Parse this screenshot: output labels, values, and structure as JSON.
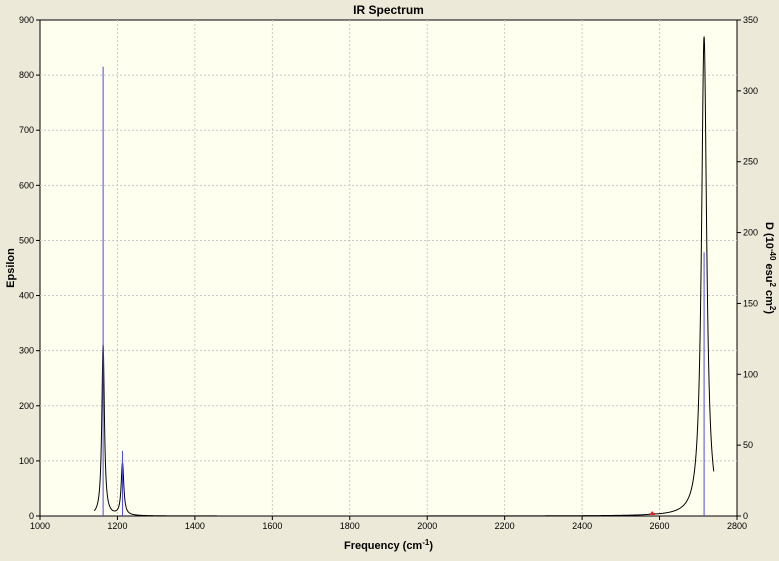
{
  "chart_data": {
    "type": "line",
    "title": "IR Spectrum",
    "xlabel": "Frequency (cm",
    "xlabel_sup": "-1",
    "xlabel_suffix": ")",
    "ylabel_left": "Epsilon",
    "ylabel_right_prefix": "D (10",
    "ylabel_right_sup1": "-40",
    "ylabel_right_mid": " esu",
    "ylabel_right_sup2": "2",
    "ylabel_right_mid2": " cm",
    "ylabel_right_sup3": "2",
    "ylabel_right_suffix": ")",
    "xlim": [
      1000,
      2800
    ],
    "ylim_left": [
      0,
      900
    ],
    "ylim_right": [
      0,
      350
    ],
    "x_ticks": [
      "1000",
      "1200",
      "1400",
      "1600",
      "1800",
      "2000",
      "2200",
      "2400",
      "2600",
      "2800"
    ],
    "y_left_ticks": [
      "0",
      "100",
      "200",
      "300",
      "400",
      "500",
      "600",
      "700",
      "800",
      "900"
    ],
    "y_right_ticks": [
      "0",
      "50",
      "100",
      "150",
      "200",
      "250",
      "300",
      "350"
    ],
    "grid": true,
    "series": [
      {
        "kind": "spectrum",
        "color": "#000000",
        "peaks": [
          {
            "x": 1163,
            "epsilon": 310,
            "hwhm": 4
          },
          {
            "x": 1213,
            "epsilon": 95,
            "hwhm": 4
          },
          {
            "x": 2581,
            "epsilon": 2,
            "hwhm": 4
          },
          {
            "x": 2715,
            "epsilon": 870,
            "hwhm": 8
          }
        ],
        "x_range": [
          1140,
          2740
        ]
      },
      {
        "kind": "sticks",
        "color": "#4b4bdc",
        "sticks": [
          {
            "x": 1163,
            "D": 317
          },
          {
            "x": 1213,
            "D": 46
          },
          {
            "x": 2715,
            "D": 186
          }
        ]
      }
    ],
    "marker": {
      "x": 2581,
      "y": 0,
      "color": "#e02020"
    }
  }
}
